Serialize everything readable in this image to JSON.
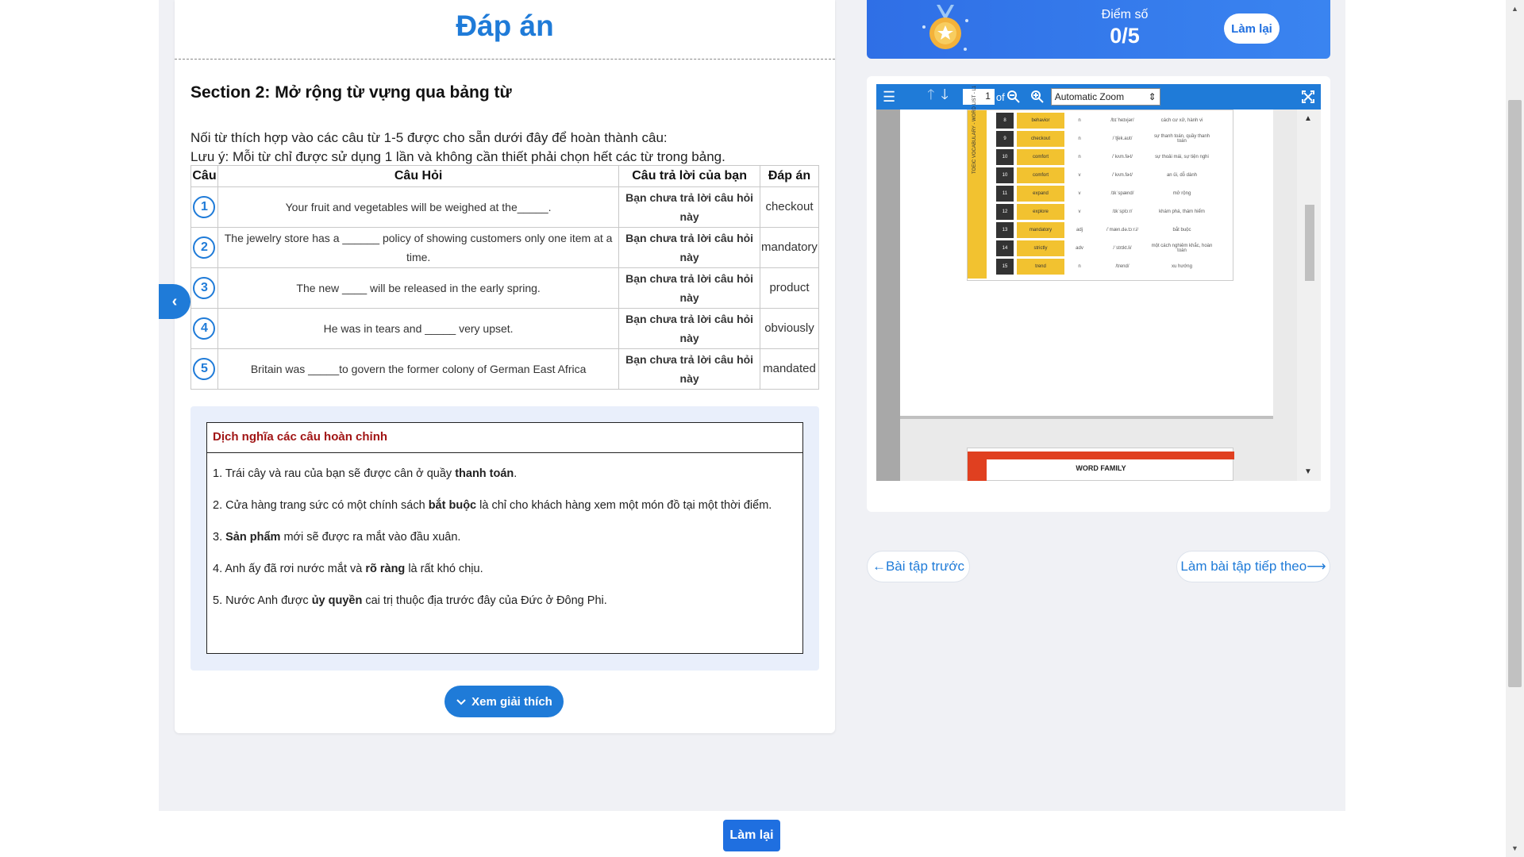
{
  "left": {
    "title": "Đáp án",
    "section_title": "Section 2: Mở rộng từ vựng qua bảng từ",
    "instruction_1": "Nối từ thích hợp vào các câu từ 1-5 được cho sẵn dưới đây để hoàn thành câu:",
    "instruction_2": "Lưu ý: Mỗi từ chỉ được sử dụng 1 lần và không cần thiết phải chọn hết các từ trong bảng.",
    "table": {
      "headers": [
        "Câu",
        "Câu Hỏi",
        "Câu trả lời của bạn",
        "Đáp án"
      ],
      "rows": [
        {
          "num": "1",
          "question": "Your fruit and vegetables will be weighed at the_____.",
          "your_answer": "Bạn chưa trả lời câu hỏi này",
          "answer": "checkout"
        },
        {
          "num": "2",
          "question": "The jewelry store has a ______ policy of showing customers only one item at a time.",
          "your_answer": "Bạn chưa trả lời câu hỏi này",
          "answer": "mandatory"
        },
        {
          "num": "3",
          "question": "The new ____ will be released in the early spring.",
          "your_answer": "Bạn chưa trả lời câu hỏi này",
          "answer": "product"
        },
        {
          "num": "4",
          "question": "He was in tears and _____ very upset.",
          "your_answer": "Bạn chưa trả lời câu hỏi này",
          "answer": "obviously"
        },
        {
          "num": "5",
          "question": "Britain was _____to govern the former colony of German East Africa",
          "your_answer": "Bạn chưa trả lời câu hỏi này",
          "answer": "mandated"
        }
      ]
    },
    "translation": {
      "heading": "Dịch nghĩa các câu hoàn chỉnh",
      "lines": [
        {
          "before": "1. Trái cây và rau của bạn sẽ được cân ở quầy ",
          "bold": "thanh toán",
          "after": "."
        },
        {
          "before": "2. Cửa hàng trang sức có một chính sách ",
          "bold": "bắt buộc",
          "after": " là chỉ cho khách hàng xem một món đồ tại một thời điểm."
        },
        {
          "before": "3. ",
          "bold": "Sản phẩm",
          "after": " mới sẽ được ra mắt vào đầu xuân."
        },
        {
          "before": "4. Anh ấy đã rơi nước mắt và ",
          "bold": "rõ ràng",
          "after": " là rất khó chịu."
        },
        {
          "before": "5. Nước Anh được ",
          "bold": "ủy quyền",
          "after": " cai trị thuộc địa trước đây của Đức ở Đông Phi."
        }
      ]
    },
    "explain_button": "Xem giải thích",
    "side_toggle_icon": "‹"
  },
  "score": {
    "label": "Điểm số",
    "value": "0/5",
    "retry": "Làm lại",
    "accent": "#2f6fe6"
  },
  "viewer": {
    "page_number": "1",
    "of_label": "of",
    "zoom": "Automatic Zoom",
    "sidebar_text": "TOEIC VOCABULARY - WORD LIST - L1",
    "page2_title": "WORD FAMILY",
    "vocab_rows": [
      {
        "n": "8",
        "word": "behavior",
        "pos": "n",
        "ipa": "/bɪˈheɪvjər/",
        "mean": "cách cư xử, hành vi"
      },
      {
        "n": "9",
        "word": "checkout",
        "pos": "n",
        "ipa": "/ˈtʃek.aʊt/",
        "mean": "sự thanh toán, quầy thanh toán"
      },
      {
        "n": "10",
        "word": "comfort",
        "pos": "n",
        "ipa": "/ˈkʌm.fɚt/",
        "mean": "sự thoải mái, sự tiện nghi"
      },
      {
        "n": "10",
        "word": "comfort",
        "pos": "v",
        "ipa": "/ˈkʌm.fɚt/",
        "mean": "an ủi, dỗ dành"
      },
      {
        "n": "11",
        "word": "expand",
        "pos": "v",
        "ipa": "/ɪkˈspænd/",
        "mean": "mở rộng"
      },
      {
        "n": "12",
        "word": "explore",
        "pos": "v",
        "ipa": "/ɪkˈsplɔːr/",
        "mean": "khám phá, thám hiểm"
      },
      {
        "n": "13",
        "word": "mandatory",
        "pos": "adj",
        "ipa": "/ˈmæn.də.tɔːr.i/",
        "mean": "bắt buộc"
      },
      {
        "n": "14",
        "word": "strictly",
        "pos": "adv",
        "ipa": "/ˈstrɪkt.li/",
        "mean": "một cách nghiêm khắc, hoàn toàn"
      },
      {
        "n": "15",
        "word": "trend",
        "pos": "n",
        "ipa": "/trend/",
        "mean": "xu hướng"
      }
    ]
  },
  "nav": {
    "prev": "←Bài tập trước",
    "next": "Làm bài tập tiếp theo⟶"
  },
  "bottom": {
    "retry": "Làm lại"
  }
}
